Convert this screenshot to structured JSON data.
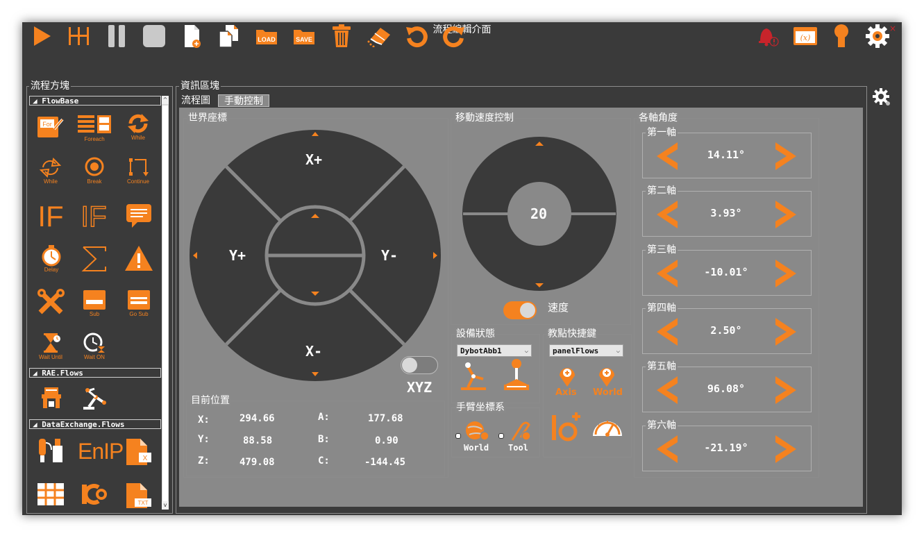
{
  "window": {
    "title": "流程編輯介面",
    "close": "×"
  },
  "toolbar": {
    "items": [
      {
        "name": "run"
      },
      {
        "name": "step"
      },
      {
        "name": "pause"
      },
      {
        "name": "stop"
      },
      {
        "name": "new-file"
      },
      {
        "name": "copy"
      },
      {
        "name": "load",
        "label": "LOAD"
      },
      {
        "name": "save",
        "label": "SAVE"
      },
      {
        "name": "delete"
      },
      {
        "name": "clear"
      },
      {
        "name": "undo"
      },
      {
        "name": "redo"
      }
    ],
    "right_items": [
      {
        "name": "alarm"
      },
      {
        "name": "variables",
        "label": "(x)"
      },
      {
        "name": "user"
      },
      {
        "name": "settings"
      }
    ]
  },
  "left_panel": {
    "title": "流程方塊",
    "sections": [
      {
        "title": "FlowBase",
        "items": [
          {
            "icon": "for-icon",
            "label": "For"
          },
          {
            "icon": "foreach-icon",
            "label": "Foreach"
          },
          {
            "icon": "while-icon",
            "label": "While"
          },
          {
            "icon": "while-outline-icon",
            "label": "While"
          },
          {
            "icon": "break-icon",
            "label": "Break"
          },
          {
            "icon": "continue-icon",
            "label": "Continue"
          },
          {
            "icon": "if-icon",
            "label": "IF"
          },
          {
            "icon": "if-outline-icon",
            "label": "IF"
          },
          {
            "icon": "message-icon",
            "label": ""
          },
          {
            "icon": "delay-icon",
            "label": "Delay"
          },
          {
            "icon": "sum-icon",
            "label": ""
          },
          {
            "icon": "warning-icon",
            "label": ""
          },
          {
            "icon": "tools-icon",
            "label": ""
          },
          {
            "icon": "sub-icon",
            "label": "Sub"
          },
          {
            "icon": "go-sub-icon",
            "label": "Go Sub"
          },
          {
            "icon": "wait-until-icon",
            "label": "Wait Until"
          },
          {
            "icon": "wait-on-icon",
            "label": "Wait ON"
          }
        ]
      },
      {
        "title": "RAE.Flows",
        "items": [
          {
            "icon": "gripper-icon"
          },
          {
            "icon": "robot-arm-icon"
          }
        ]
      },
      {
        "title": "DataExchange.Flows",
        "items": [
          {
            "icon": "plc-icon"
          },
          {
            "icon": "enip-icon",
            "label": "EnIP"
          },
          {
            "icon": "excel-file-icon",
            "label": "X"
          },
          {
            "icon": "table-icon"
          },
          {
            "icon": "io-link-icon"
          },
          {
            "icon": "txt-file-icon",
            "label": "TXT"
          }
        ]
      }
    ]
  },
  "info_panel": {
    "title": "資訊區塊",
    "tabs": [
      "流程圖",
      "手動控制"
    ],
    "active_tab": 1
  },
  "world_coord": {
    "title": "世界座標",
    "x_plus": "X+",
    "x_minus": "X-",
    "y_plus": "Y+",
    "y_minus": "Y-",
    "mode_label": "XYZ"
  },
  "position": {
    "title": "目前位置",
    "rows": [
      {
        "l1": "X:",
        "v1": "294.66",
        "l2": "A:",
        "v2": "177.68"
      },
      {
        "l1": "Y:",
        "v1": "88.58",
        "l2": "B:",
        "v2": "0.90"
      },
      {
        "l1": "Z:",
        "v1": "479.08",
        "l2": "C:",
        "v2": "-144.45"
      }
    ]
  },
  "speed": {
    "title": "移動速度控制",
    "value": "20",
    "toggle_label": "速度"
  },
  "device": {
    "title": "設備狀態",
    "selected": "DybotAbb1"
  },
  "teach": {
    "title": "教點快捷鍵",
    "selected": "panelFlows",
    "axis_label": "Axis",
    "world_label": "World"
  },
  "arm_coord": {
    "title": "手臂坐標系",
    "world": "World",
    "tool": "Tool"
  },
  "joints": {
    "title": "各軸角度",
    "items": [
      {
        "name": "第一軸",
        "value": "14.11°"
      },
      {
        "name": "第二軸",
        "value": "3.93°"
      },
      {
        "name": "第三軸",
        "value": "-10.01°"
      },
      {
        "name": "第四軸",
        "value": "2.50°"
      },
      {
        "name": "第五軸",
        "value": "96.08°"
      },
      {
        "name": "第六軸",
        "value": "-21.19°"
      }
    ]
  },
  "colors": {
    "accent": "#f5821f",
    "background": "#3a3a3a",
    "panel": "#898989",
    "pad": "#3a3a3a"
  }
}
